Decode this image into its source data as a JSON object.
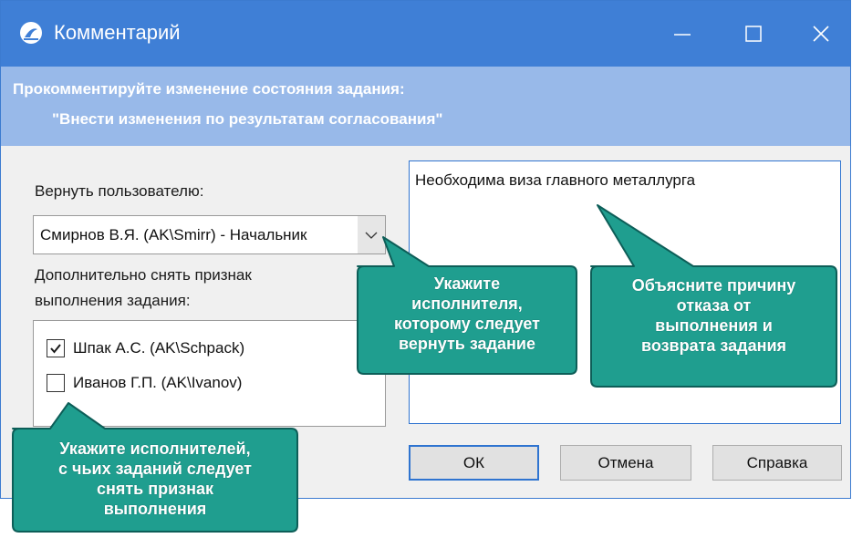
{
  "window": {
    "title": "Комментарий",
    "controls": {
      "minimize": "minimize",
      "maximize": "maximize",
      "close": "close"
    }
  },
  "header": {
    "prompt": "Прокомментируйте изменение состояния задания:",
    "state_name": "\"Внести изменения по результатам согласования\""
  },
  "form": {
    "return_label": "Вернуть пользователю:",
    "return_user": "Смирнов В.Я. (AK\\Smirr) - Начальник",
    "clear_label_line1": "Дополнительно снять признак",
    "clear_label_line2": "выполнения задания:",
    "executors": [
      {
        "name": "Шпак А.С. (AK\\Schpack)",
        "checked": true
      },
      {
        "name": "Иванов Г.П. (AK\\Ivanov)",
        "checked": false
      }
    ],
    "comment": "Необходима виза главного металлурга"
  },
  "buttons": {
    "ok": "ОК",
    "cancel": "Отмена",
    "help": "Справка"
  },
  "callouts": {
    "executor": [
      "Укажите",
      "исполнителя,",
      "которому следует",
      "вернуть задание"
    ],
    "reason": [
      "Объясните причину",
      "отказа от",
      "выполнения и",
      "возврата задания"
    ],
    "executors_clear": [
      "Укажите исполнителей,",
      "с чьих заданий следует",
      "снять признак",
      "выполнения"
    ]
  },
  "colors": {
    "titlebar": "#3f7fd6",
    "header": "#98b9e9",
    "callout_fill": "#1f9e8f",
    "callout_border": "#0d5e58",
    "focus": "#2f74d0"
  }
}
